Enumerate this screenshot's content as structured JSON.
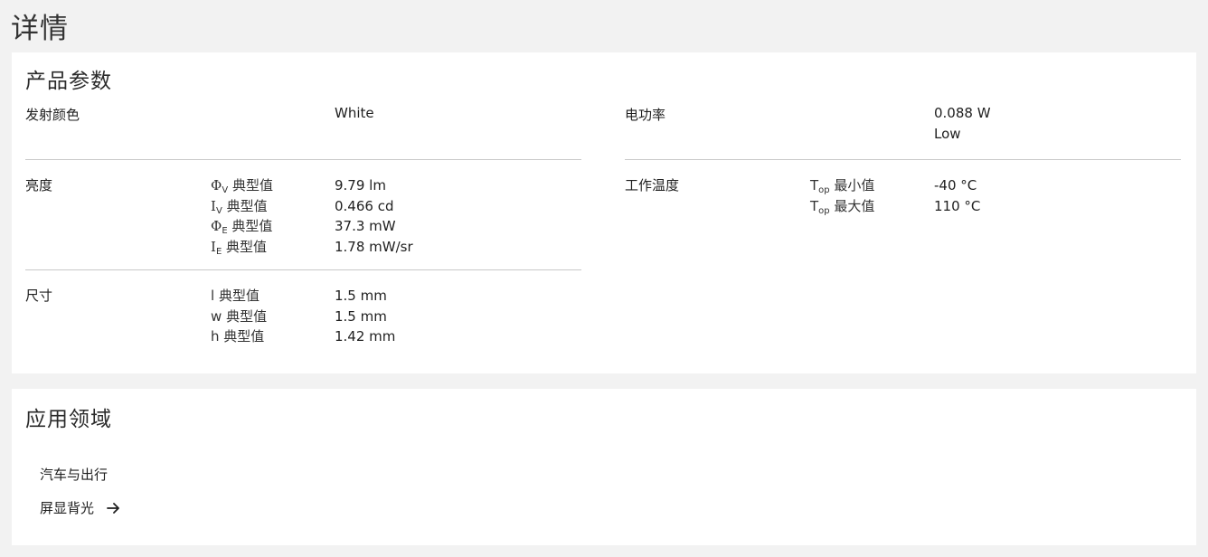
{
  "page": {
    "title": "详情"
  },
  "params": {
    "title": "产品参数",
    "emission_color": {
      "label": "发射颜色",
      "value": "White"
    },
    "brightness": {
      "label": "亮度",
      "items": [
        {
          "symbol": "Φ",
          "subscript": "V",
          "qualifier": "典型值",
          "value": "9.79 lm"
        },
        {
          "symbol": "I",
          "subscript": "V",
          "qualifier": "典型值",
          "value": "0.466 cd"
        },
        {
          "symbol": "Φ",
          "subscript": "E",
          "qualifier": "典型值",
          "value": "37.3 mW"
        },
        {
          "symbol": "I",
          "subscript": "E",
          "qualifier": "典型值",
          "value": "1.78 mW/sr"
        }
      ]
    },
    "size": {
      "label": "尺寸",
      "items": [
        {
          "symbol": "l",
          "qualifier": "典型值",
          "value": "1.5 mm"
        },
        {
          "symbol": "w",
          "qualifier": "典型值",
          "value": "1.5 mm"
        },
        {
          "symbol": "h",
          "qualifier": "典型值",
          "value": "1.42 mm"
        }
      ]
    },
    "electrical_power": {
      "label": "电功率",
      "value": "0.088 W",
      "class": "Low"
    },
    "operating_temp": {
      "label": "工作温度",
      "items": [
        {
          "symbol": "T",
          "subscript": "op",
          "qualifier": "最小值",
          "value": "-40 °C"
        },
        {
          "symbol": "T",
          "subscript": "op",
          "qualifier": "最大值",
          "value": "110 °C"
        }
      ]
    }
  },
  "applications": {
    "title": "应用领域",
    "category": "汽车与出行",
    "link_label": "屏显背光",
    "link_icon": "arrow-right-icon"
  }
}
